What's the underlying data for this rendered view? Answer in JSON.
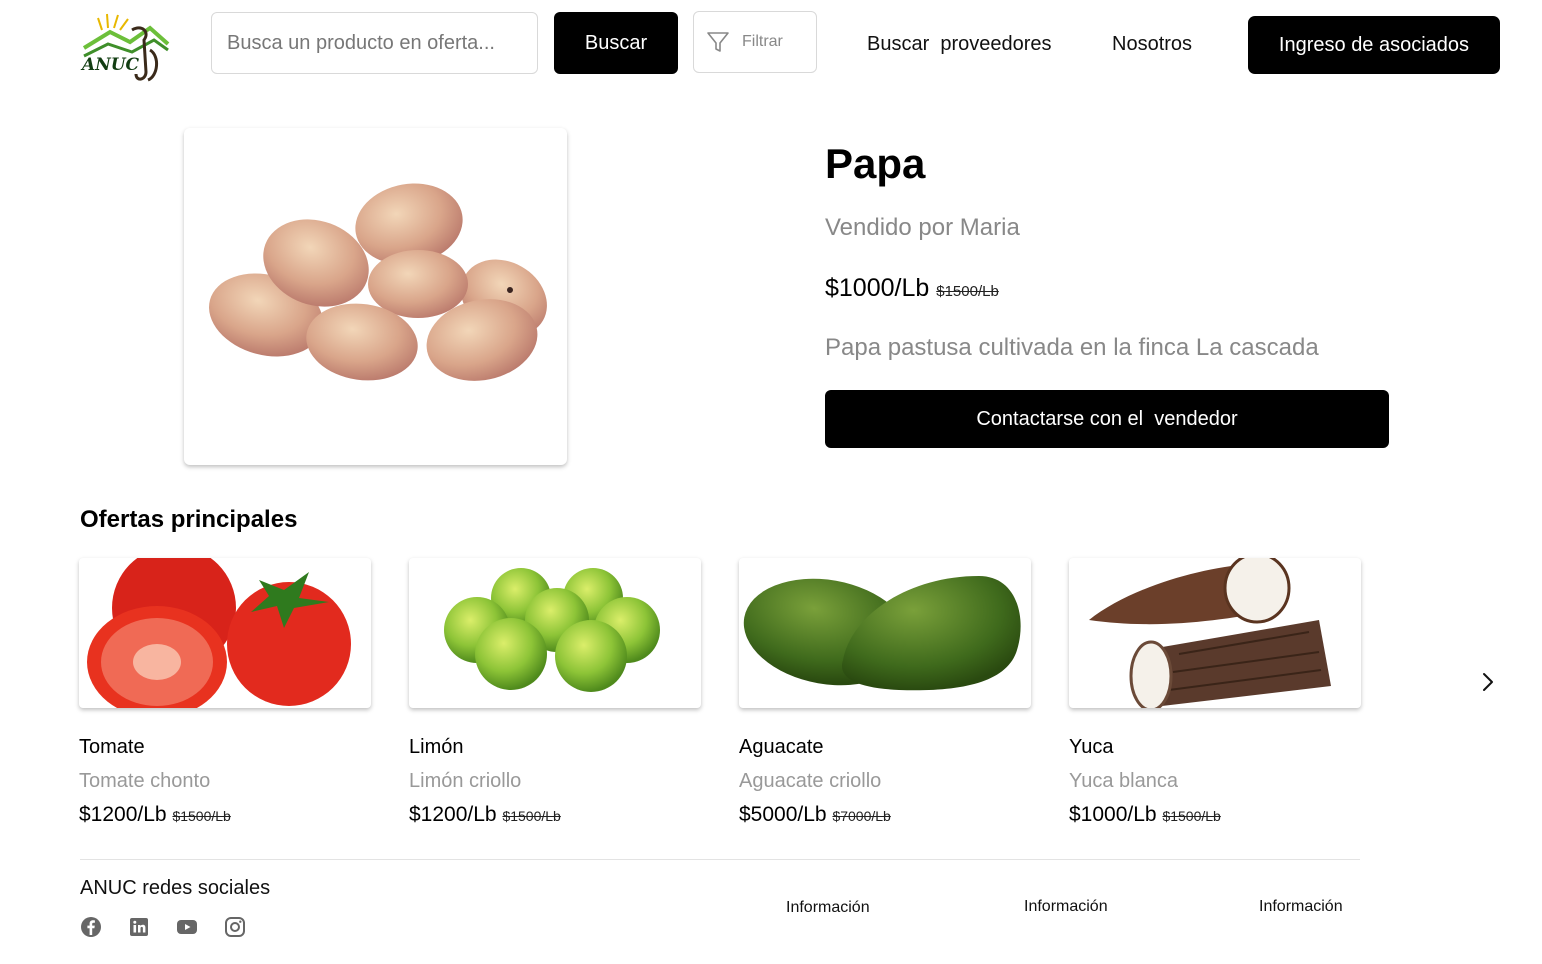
{
  "header": {
    "logo_text": "ANUC",
    "search_placeholder": "Busca un producto en oferta...",
    "search_button": "Buscar",
    "filter_label": "Filtrar",
    "nav": [
      "Buscar  proveedores",
      "Nosotros"
    ],
    "login_button": "Ingreso de asociados"
  },
  "product": {
    "image_icon": "potatoes-image",
    "title": "Papa",
    "seller": "Vendido por Maria",
    "price": "$1000/Lb",
    "old_price": "$1500/Lb",
    "description": "Papa pastusa cultivada en la finca La cascada",
    "contact_button": "Contactarse con el  vendedor"
  },
  "offers": {
    "title": "Ofertas principales",
    "items": [
      {
        "name": "Tomate",
        "subtitle": "Tomate chonto",
        "price": "$1200/Lb",
        "old_price": "$1500/Lb",
        "image": "tomato-image"
      },
      {
        "name": "Limón",
        "subtitle": "Limón criollo",
        "price": "$1200/Lb",
        "old_price": "$1500/Lb",
        "image": "lime-image"
      },
      {
        "name": "Aguacate",
        "subtitle": "Aguacate criollo",
        "price": "$5000/Lb",
        "old_price": "$7000/Lb",
        "image": "avocado-image"
      },
      {
        "name": "Yuca",
        "subtitle": "Yuca blanca",
        "price": "$1000/Lb",
        "old_price": "$1500/Lb",
        "image": "cassava-image"
      }
    ],
    "next_icon": "chevron-right-icon"
  },
  "footer": {
    "title": "ANUC redes sociales",
    "social_icons": [
      "facebook-icon",
      "linkedin-icon",
      "youtube-icon",
      "instagram-icon"
    ],
    "info_links": [
      "Información",
      "Información",
      "Información"
    ]
  }
}
